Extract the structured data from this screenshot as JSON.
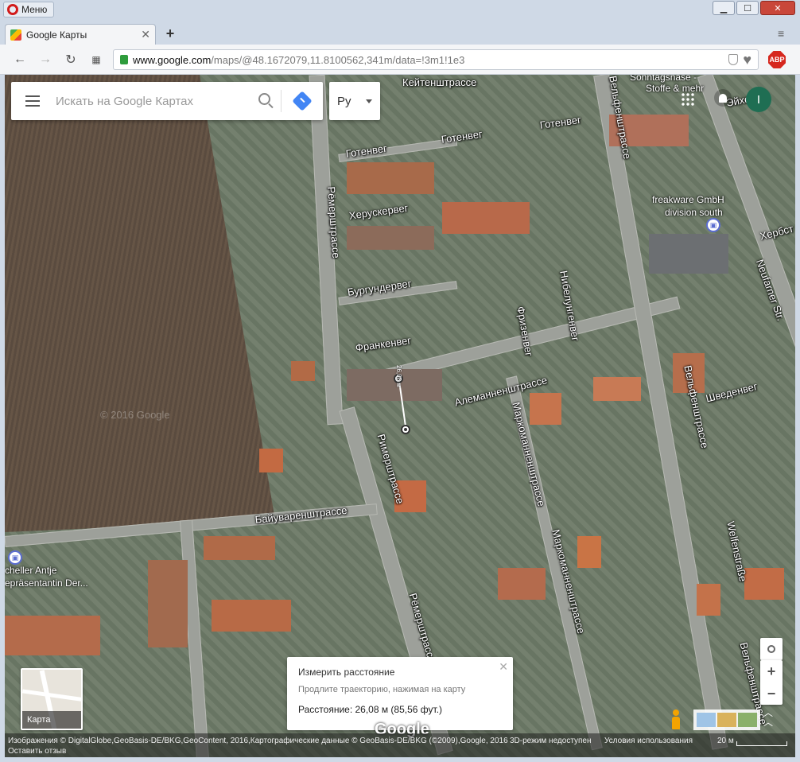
{
  "browser": {
    "menu_label": "Меню",
    "tab_title": "Google Карты",
    "url_domain": "www.google.com",
    "url_path": "/maps/@48.1672079,11.8100562,341m/data=!3m1!1e3",
    "abp_label": "ABP"
  },
  "search": {
    "placeholder": "Искать на Google Картах"
  },
  "language": {
    "label": "Ру"
  },
  "account": {
    "initial": "I"
  },
  "streets": {
    "s1": "Кейтенштрассе",
    "s2": "Готенвег",
    "s3": "Готенвег",
    "s4": "Готенвег",
    "s5": "Херускервег",
    "s6": "Бургундервег",
    "s7": "Франкенвег",
    "s8": "Алеманненштрассе",
    "s9": "Рёмерштрассе",
    "s10": "Рёмерштрассе",
    "s11": "Римерштрассе",
    "s12": "Байуваренштрассе",
    "s13": "Маркоманненштрассе",
    "s14": "Маркоманненштрассе",
    "s15": "Нибелунгенвег",
    "s16": "Фризенвег",
    "s17": "Вельфенштрассе",
    "s18": "Вельфенштрассе",
    "s19": "Вельфенштрассе",
    "s20": "Welfenstraße",
    "s21": "Шведенвег",
    "s22": "Neufarner Str.",
    "s23": "Хербст",
    "s24": "Эйхе"
  },
  "pois": {
    "p1": "Sonntagsnase -",
    "p1b": "Stoffe & mehr",
    "p2": "freakware GmbH",
    "p2b": "division south",
    "p3": "cheller Antje",
    "p3b": "epräsentantin Der..."
  },
  "watermark": "© 2016 Google",
  "measure": {
    "on_map": "26,08 м",
    "title": "Измерить расстояние",
    "hint": "Продлите траекторию, нажимая на карту",
    "distance": "Расстояние: 26,08 м (85,56 фут.)"
  },
  "layer": {
    "label": "Карта"
  },
  "logo": "Google",
  "footer": {
    "imagery": "Изображения © DigitalGlobe,GeoBasis-DE/BKG,GeoContent, 2016,Картографические данные © GeoBasis-DE/BKG (©2009),Google, 2016",
    "feedback": "Оставить отзыв",
    "no3d": "3D-режим недоступен",
    "terms": "Условия использования",
    "scale": "20 м"
  }
}
